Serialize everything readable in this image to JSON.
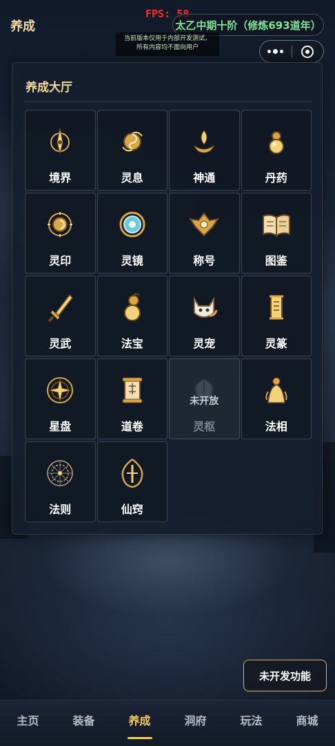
{
  "header": {
    "title": "养成",
    "fps_text": "FPS: 58",
    "realm_text": "太乙中期十阶（修炼693道年）",
    "notice_line1": "当前版本仅用于内部开发测试，",
    "notice_line2": "所有内容均不面向用户"
  },
  "capsule": {
    "more_icon": "more-dots-icon",
    "close_icon": "target-close-icon"
  },
  "panel": {
    "title": "养成大厅",
    "items": [
      {
        "label": "境界",
        "icon": "compass-sword-icon",
        "locked": false
      },
      {
        "label": "灵息",
        "icon": "swirl-orb-icon",
        "locked": false
      },
      {
        "label": "神通",
        "icon": "lotus-flame-icon",
        "locked": false
      },
      {
        "label": "丹药",
        "icon": "gourd-pill-icon",
        "locked": false
      },
      {
        "label": "灵印",
        "icon": "seal-medallion-icon",
        "locked": false
      },
      {
        "label": "灵镜",
        "icon": "mirror-icon",
        "locked": false
      },
      {
        "label": "称号",
        "icon": "crest-badge-icon",
        "locked": false
      },
      {
        "label": "图鉴",
        "icon": "open-book-icon",
        "locked": false
      },
      {
        "label": "灵武",
        "icon": "sword-icon",
        "locked": false
      },
      {
        "label": "法宝",
        "icon": "treasure-gourd-icon",
        "locked": false
      },
      {
        "label": "灵宠",
        "icon": "pet-cat-icon",
        "locked": false
      },
      {
        "label": "灵篆",
        "icon": "talisman-scroll-icon",
        "locked": false
      },
      {
        "label": "星盘",
        "icon": "star-disc-icon",
        "locked": false
      },
      {
        "label": "道卷",
        "icon": "dao-scroll-icon",
        "locked": false
      },
      {
        "label": "灵枢",
        "icon": "pivot-icon",
        "locked": true,
        "lock_text": "未开放"
      },
      {
        "label": "法相",
        "icon": "avatar-figure-icon",
        "locked": false
      },
      {
        "label": "法则",
        "icon": "rune-circle-icon",
        "locked": false
      },
      {
        "label": "仙窍",
        "icon": "immortal-aperture-icon",
        "locked": false
      }
    ]
  },
  "undeveloped_button": "未开发功能",
  "nav": {
    "items": [
      {
        "label": "主页",
        "active": false
      },
      {
        "label": "装备",
        "active": false
      },
      {
        "label": "养成",
        "active": true
      },
      {
        "label": "洞府",
        "active": false
      },
      {
        "label": "玩法",
        "active": false
      },
      {
        "label": "商城",
        "active": false
      }
    ]
  },
  "colors": {
    "gold": "#f1d9a0",
    "accent": "#f4c85c",
    "fps": "#ff2a2a",
    "realm": "#7fe39a"
  }
}
